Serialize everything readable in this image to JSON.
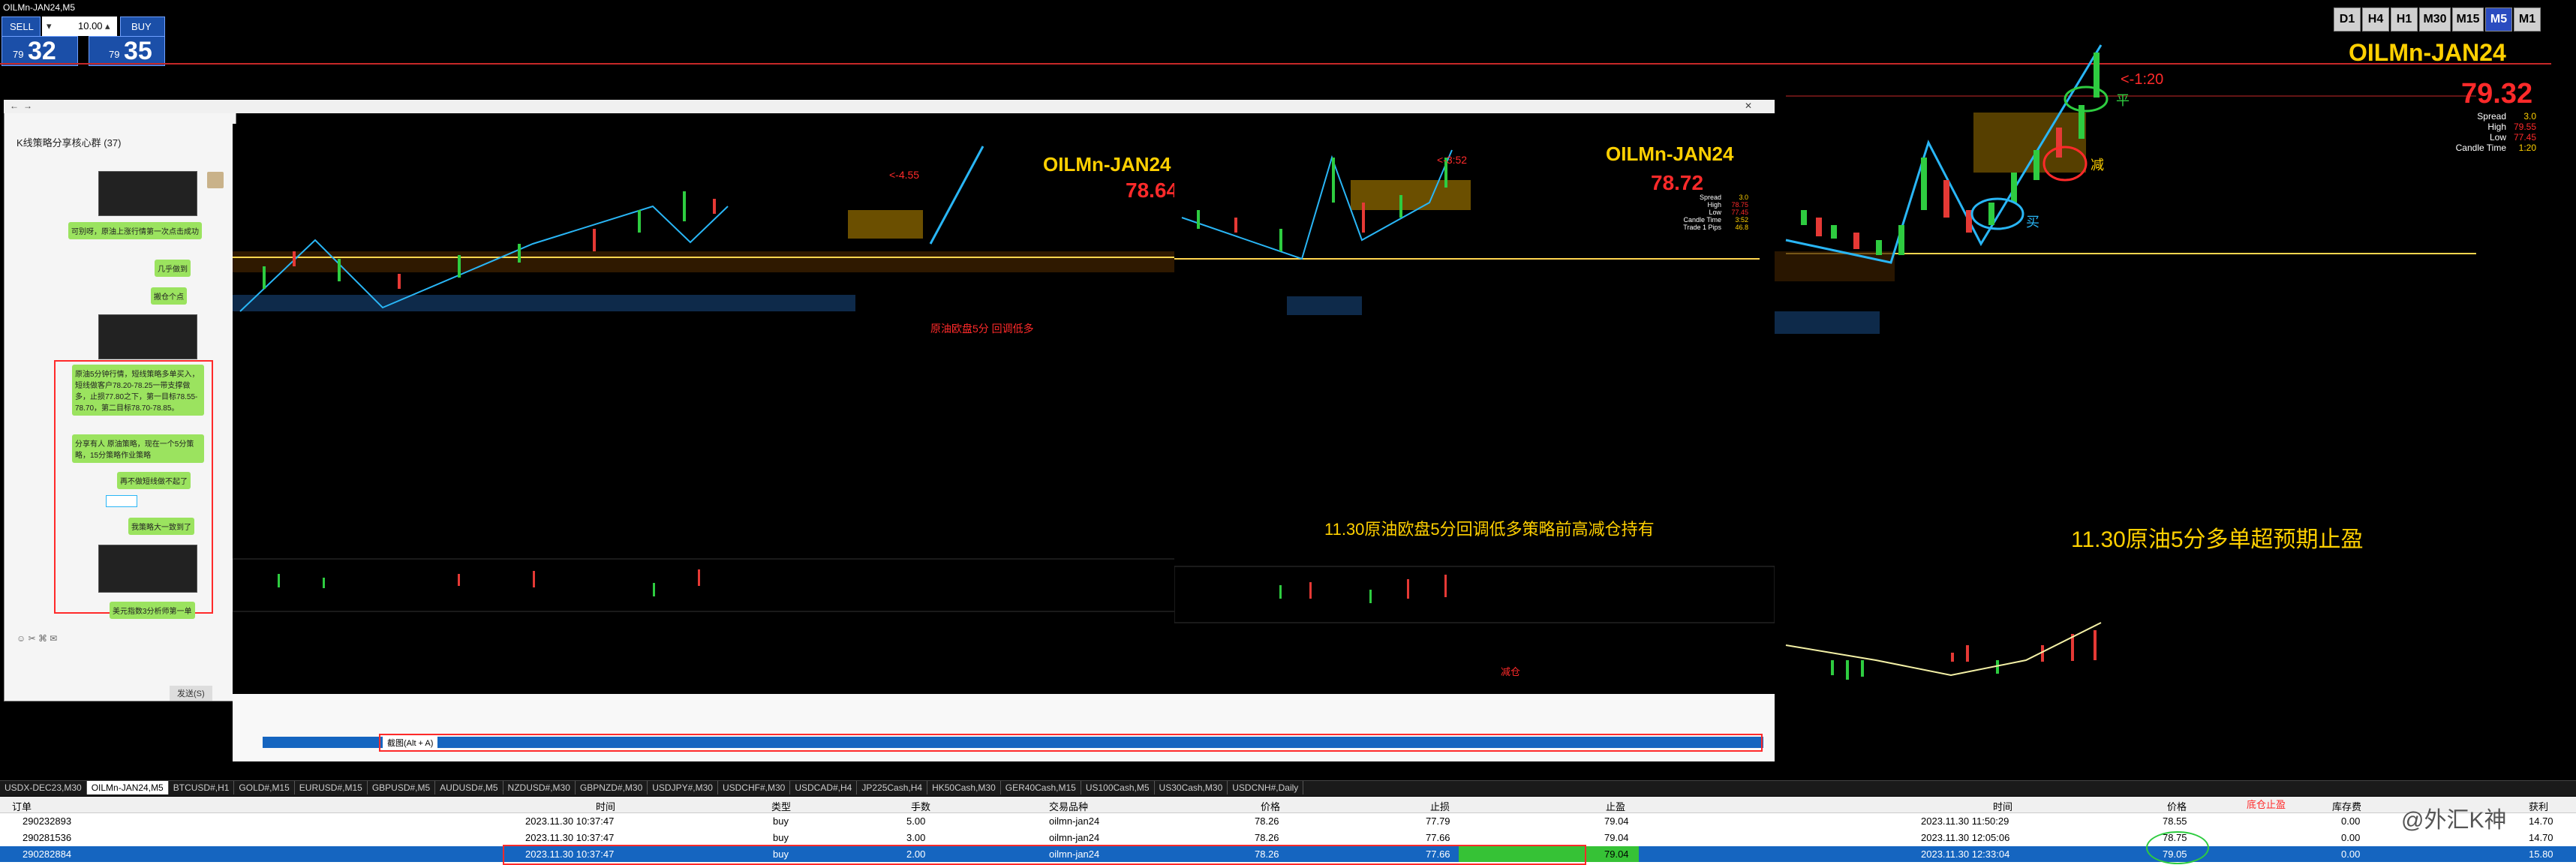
{
  "window_title": "OILMn-JAN24,M5",
  "trade_panel": {
    "sell_label": "SELL",
    "buy_label": "BUY",
    "lot_value": "10.00",
    "sell_price_prefix": "79",
    "sell_price_big": "32",
    "buy_price_prefix": "79",
    "buy_price_big": "35"
  },
  "timeframes": [
    "D1",
    "H4",
    "H1",
    "M30",
    "M15",
    "M5",
    "M1"
  ],
  "active_timeframe": "M5",
  "main_chart": {
    "symbol": "OILMn-JAN24",
    "price": "79.32",
    "info": [
      {
        "label": "Spread",
        "value": "3.0"
      },
      {
        "label": "High",
        "value": "79.55"
      },
      {
        "label": "Low",
        "value": "77.45"
      },
      {
        "label": "Candle Time",
        "value": "1:20"
      }
    ],
    "annotation_ratio": "<-1:20",
    "annotation_ping": "平",
    "annotation_jian": "减",
    "annotation_mai": "买",
    "caption": "11.30原油5分多单超预期止盈"
  },
  "chat_window": {
    "group_title": "K线策略分享核心群 (37)",
    "messages": [
      "可别呀，原油上涨行情第一次点击成功",
      "几乎做到",
      "搬仓个点",
      "原油5分钟行情，短线策略多单买入，短线做客户78.20-78.25一带支撑做多，止损77.80之下，第一目标78.55-78.70，第二目标78.70-78.85。",
      "分享有人 原油策略，现在一个5分策略，15分策略作业策略",
      "再不做短线做不起了",
      "我策略大一致到了",
      "美元指数3分析师第一单"
    ],
    "send_label": "发送(S)"
  },
  "inner_chart_left": {
    "symbol": "OILMn-JAN24",
    "price": "78.64",
    "annotation": "<-4.55",
    "caption": "原油欧盘5分 回调低多"
  },
  "inner_chart_right": {
    "symbol": "OILMn-JAN24",
    "price": "78.72",
    "annotation": "<-3:52",
    "caption": "11.30原油欧盘5分回调低多策略前高减仓持有",
    "info": [
      {
        "label": "Spread",
        "value": "3.0"
      },
      {
        "label": "High",
        "value": "78.75"
      },
      {
        "label": "Low",
        "value": "77.45"
      },
      {
        "label": "Candle Time",
        "value": "3:52"
      },
      {
        "label": "Trade 1 Pips",
        "value": "46.8"
      }
    ]
  },
  "inner_table_note": "减仓",
  "inner_screenshot_hint": "截图(Alt + A)",
  "symbol_tabs": [
    "USDX-DEC23,M30",
    "OILMn-JAN24,M5",
    "BTCUSD#,H1",
    "GOLD#,M15",
    "EURUSD#,M15",
    "GBPUSD#,M5",
    "AUDUSD#,M5",
    "NZDUSD#,M30",
    "GBPNZD#,M30",
    "USDJPY#,M30",
    "USDCHF#,M30",
    "USDCAD#,H4",
    "JP225Cash,H4",
    "HK50Cash,M30",
    "GER40Cash,M15",
    "US100Cash,M5",
    "US30Cash,M30",
    "USDCNH#,Daily"
  ],
  "active_tab": "OILMn-JAN24,M5",
  "orders_table": {
    "headers": [
      "订单",
      "时间",
      "类型",
      "手数",
      "交易品种",
      "价格",
      "止损",
      "止盈",
      "时间",
      "价格",
      "库存费",
      "获利"
    ],
    "rows": [
      [
        "290232893",
        "2023.11.30 10:37:47",
        "buy",
        "5.00",
        "oilmn-jan24",
        "78.26",
        "77.79",
        "79.04",
        "2023.11.30 11:50:29",
        "78.55",
        "0.00",
        "14.70"
      ],
      [
        "290281536",
        "2023.11.30 10:37:47",
        "buy",
        "3.00",
        "oilmn-jan24",
        "78.26",
        "77.66",
        "79.04",
        "2023.11.30 12:05:06",
        "78.75",
        "0.00",
        "14.70"
      ],
      [
        "290282884",
        "2023.11.30 10:37:47",
        "buy",
        "2.00",
        "oilmn-jan24",
        "78.26",
        "77.66",
        "79.04",
        "2023.11.30 12:33:04",
        "79.05",
        "0.00",
        "15.80"
      ]
    ],
    "note": "底仓止盈"
  },
  "watermark": "@外汇K神",
  "colors": {
    "accent": "#ffd000",
    "bull": "#2ecc40",
    "bear": "#e53935",
    "selected_row": "#1565c0",
    "annotation_red": "#ff2a2a"
  }
}
